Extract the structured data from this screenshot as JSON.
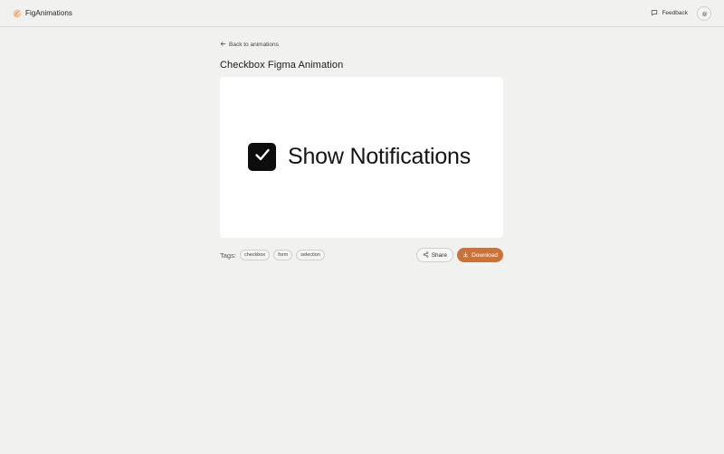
{
  "brand": {
    "name": "FigAnimations",
    "logo_icon": "swirl-logo-icon",
    "accent": "#e8914f"
  },
  "header": {
    "feedback_label": "Feedback",
    "feedback_icon": "chat-icon",
    "settings_icon": "gear-icon"
  },
  "nav": {
    "back_label": "Back to animations",
    "back_icon": "arrow-left-icon"
  },
  "page": {
    "title": "Checkbox Figma Animation"
  },
  "preview": {
    "label": "Show Notifications",
    "checked": true,
    "check_icon": "checkmark-icon"
  },
  "tags": {
    "label": "Tags:",
    "items": [
      "checkbox",
      "form",
      "selection"
    ]
  },
  "actions": {
    "share_label": "Share",
    "share_icon": "share-icon",
    "download_label": "Download",
    "download_icon": "download-icon",
    "download_color": "#c9733a"
  }
}
